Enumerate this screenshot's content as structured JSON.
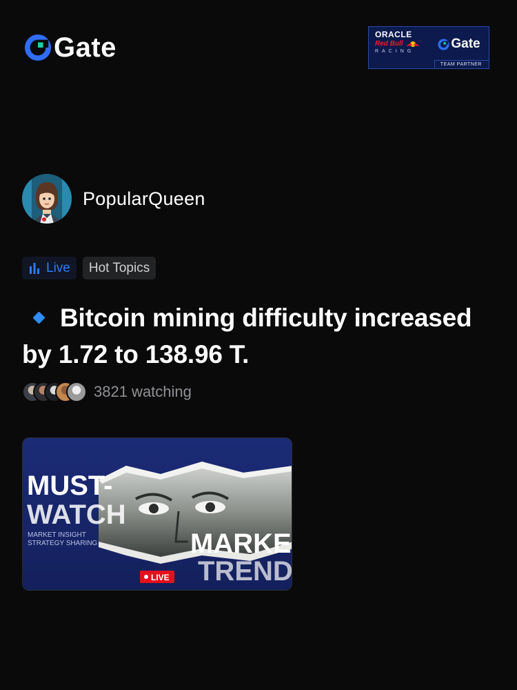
{
  "header": {
    "brand": "Gate",
    "partner": {
      "oracle": "ORACLE",
      "redbull": "Red Bull",
      "racing": "RACING",
      "gate": "Gate",
      "tagline": "TEAM PARTNER"
    }
  },
  "profile": {
    "username": "PopularQueen",
    "avatar_icon": "avatar-illustration"
  },
  "tags": {
    "live": "Live",
    "topic": "Hot Topics"
  },
  "post": {
    "headline": "Bitcoin mining difficulty increased by 1.72 to 138.96 T.",
    "watching_text": "3821 watching"
  },
  "thumbnail": {
    "line1": "MUST-",
    "line2": "WATCH",
    "sub1": "MARKET INSIGHT",
    "sub2": "STRATEGY SHARING",
    "market": "MARKET",
    "trends": "TRENDS",
    "live_badge": "LIVE"
  },
  "colors": {
    "accent": "#2f7cf6",
    "background": "#0a0a0b",
    "live_red": "#e3101e"
  }
}
